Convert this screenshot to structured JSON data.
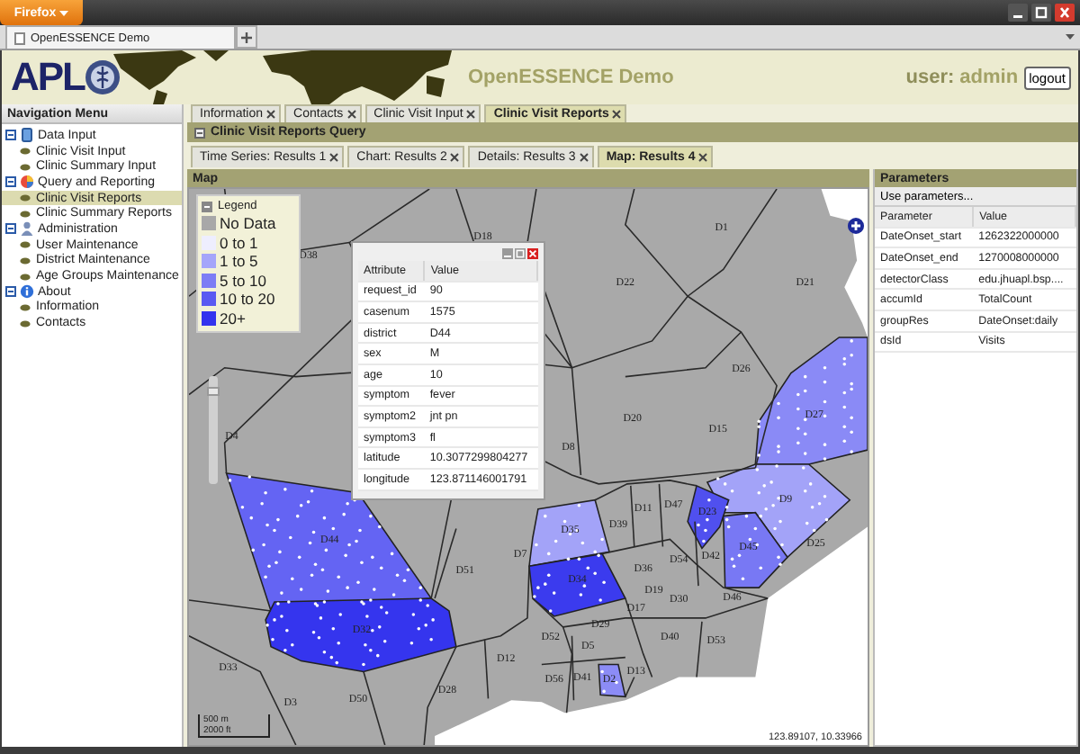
{
  "browser": {
    "menu_button": "Firefox",
    "tab": {
      "title": "OpenESSENCE Demo"
    }
  },
  "header": {
    "logo_text": "APL",
    "title": "OpenESSENCE Demo",
    "user_label": "user:",
    "user_name": "admin",
    "logout": "logout"
  },
  "navigation": {
    "title": "Navigation Menu",
    "items": [
      {
        "label": "Data Input",
        "expanded": true,
        "selected": false,
        "children": [
          {
            "label": "Clinic Visit Input",
            "selected": false
          },
          {
            "label": "Clinic Summary Input",
            "selected": false
          }
        ]
      },
      {
        "label": "Query and Reporting",
        "expanded": true,
        "selected": false,
        "children": [
          {
            "label": "Clinic Visit Reports",
            "selected": true
          },
          {
            "label": "Clinic Summary Reports",
            "selected": false
          }
        ]
      },
      {
        "label": "Administration",
        "expanded": true,
        "selected": false,
        "children": [
          {
            "label": "User Maintenance",
            "selected": false
          },
          {
            "label": "District Maintenance",
            "selected": false
          },
          {
            "label": "Age Groups Maintenance",
            "selected": false
          }
        ]
      },
      {
        "label": "About",
        "expanded": true,
        "selected": false,
        "children": [
          {
            "label": "Information",
            "selected": false
          },
          {
            "label": "Contacts",
            "selected": false
          }
        ]
      }
    ]
  },
  "tabs": [
    {
      "label": "Information",
      "selected": false
    },
    {
      "label": "Contacts",
      "selected": false
    },
    {
      "label": "Clinic Visit Input",
      "selected": false
    },
    {
      "label": "Clinic Visit Reports",
      "selected": true
    }
  ],
  "query_bar": {
    "title": "Clinic Visit Reports Query"
  },
  "result_tabs": [
    {
      "label": "Time Series: Results 1",
      "selected": false
    },
    {
      "label": "Chart: Results 2",
      "selected": false
    },
    {
      "label": "Details: Results 3",
      "selected": false
    },
    {
      "label": "Map: Results 4",
      "selected": true
    }
  ],
  "map_panel": {
    "title": "Map",
    "legend": {
      "title": "Legend",
      "entries": [
        {
          "label": "No Data",
          "color": "#a8a8a8"
        },
        {
          "label": "0 to 1",
          "color": "#eeeefe"
        },
        {
          "label": "1 to 5",
          "color": "#a5a5fa"
        },
        {
          "label": "5 to 10",
          "color": "#7d7df5"
        },
        {
          "label": "10 to 20",
          "color": "#5a5af2"
        },
        {
          "label": "20+",
          "color": "#3333ee"
        }
      ]
    },
    "zoom_slider": {
      "level": 0.9
    },
    "districts": [
      {
        "label": "D18"
      },
      {
        "label": "D1"
      },
      {
        "label": "D38"
      },
      {
        "label": "D22"
      },
      {
        "label": "D21"
      },
      {
        "label": "D26"
      },
      {
        "label": "D27",
        "color": "#8a8af6"
      },
      {
        "label": "D20"
      },
      {
        "label": "D15"
      },
      {
        "label": "D4"
      },
      {
        "label": "D8"
      },
      {
        "label": "D9",
        "color": "#a3a3f8"
      },
      {
        "label": "D11"
      },
      {
        "label": "D47"
      },
      {
        "label": "D23",
        "color": "#5050ef"
      },
      {
        "label": "D39"
      },
      {
        "label": "D35",
        "color": "#a3a3f8"
      },
      {
        "label": "D44",
        "color": "#6464f3"
      },
      {
        "label": "D45",
        "color": "#7878f4"
      },
      {
        "label": "D25"
      },
      {
        "label": "D7"
      },
      {
        "label": "D42"
      },
      {
        "label": "D54"
      },
      {
        "label": "D36"
      },
      {
        "label": "D51"
      },
      {
        "label": "D34",
        "color": "#3b3bee"
      },
      {
        "label": "D19"
      },
      {
        "label": "D30"
      },
      {
        "label": "D46"
      },
      {
        "label": "D17"
      },
      {
        "label": "D29"
      },
      {
        "label": "D32",
        "color": "#3535ee"
      },
      {
        "label": "D52"
      },
      {
        "label": "D40"
      },
      {
        "label": "D53"
      },
      {
        "label": "D5"
      },
      {
        "label": "D12"
      },
      {
        "label": "D33"
      },
      {
        "label": "D56"
      },
      {
        "label": "D41"
      },
      {
        "label": "D2",
        "color": "#8c8cf6"
      },
      {
        "label": "D13"
      },
      {
        "label": "D3"
      },
      {
        "label": "D50"
      },
      {
        "label": "D28"
      }
    ],
    "popup": {
      "columns": [
        "Attribute",
        "Value"
      ],
      "rows": [
        {
          "attribute": "request_id",
          "value": "90"
        },
        {
          "attribute": "casenum",
          "value": "1575"
        },
        {
          "attribute": "district",
          "value": "D44"
        },
        {
          "attribute": "sex",
          "value": "M"
        },
        {
          "attribute": "age",
          "value": "10"
        },
        {
          "attribute": "symptom",
          "value": "fever"
        },
        {
          "attribute": "symptom2",
          "value": "jnt pn"
        },
        {
          "attribute": "symptom3",
          "value": "fl"
        },
        {
          "attribute": "latitude",
          "value": "10.3077299804277"
        },
        {
          "attribute": "longitude",
          "value": "123.871146001791"
        }
      ]
    },
    "scale": [
      "500 m",
      "2000 ft"
    ],
    "coordinates": "123.89107, 10.33966"
  },
  "parameters": {
    "title": "Parameters",
    "button": "Use parameters...",
    "columns": [
      "Parameter",
      "Value"
    ],
    "rows": [
      {
        "parameter": "DateOnset_start",
        "value": "1262322000000"
      },
      {
        "parameter": "DateOnset_end",
        "value": "1270008000000"
      },
      {
        "parameter": "detectorClass",
        "value": "edu.jhuapl.bsp...."
      },
      {
        "parameter": "accumId",
        "value": "TotalCount"
      },
      {
        "parameter": "groupRes",
        "value": "DateOnset:daily"
      },
      {
        "parameter": "dsId",
        "value": "Visits"
      }
    ]
  }
}
